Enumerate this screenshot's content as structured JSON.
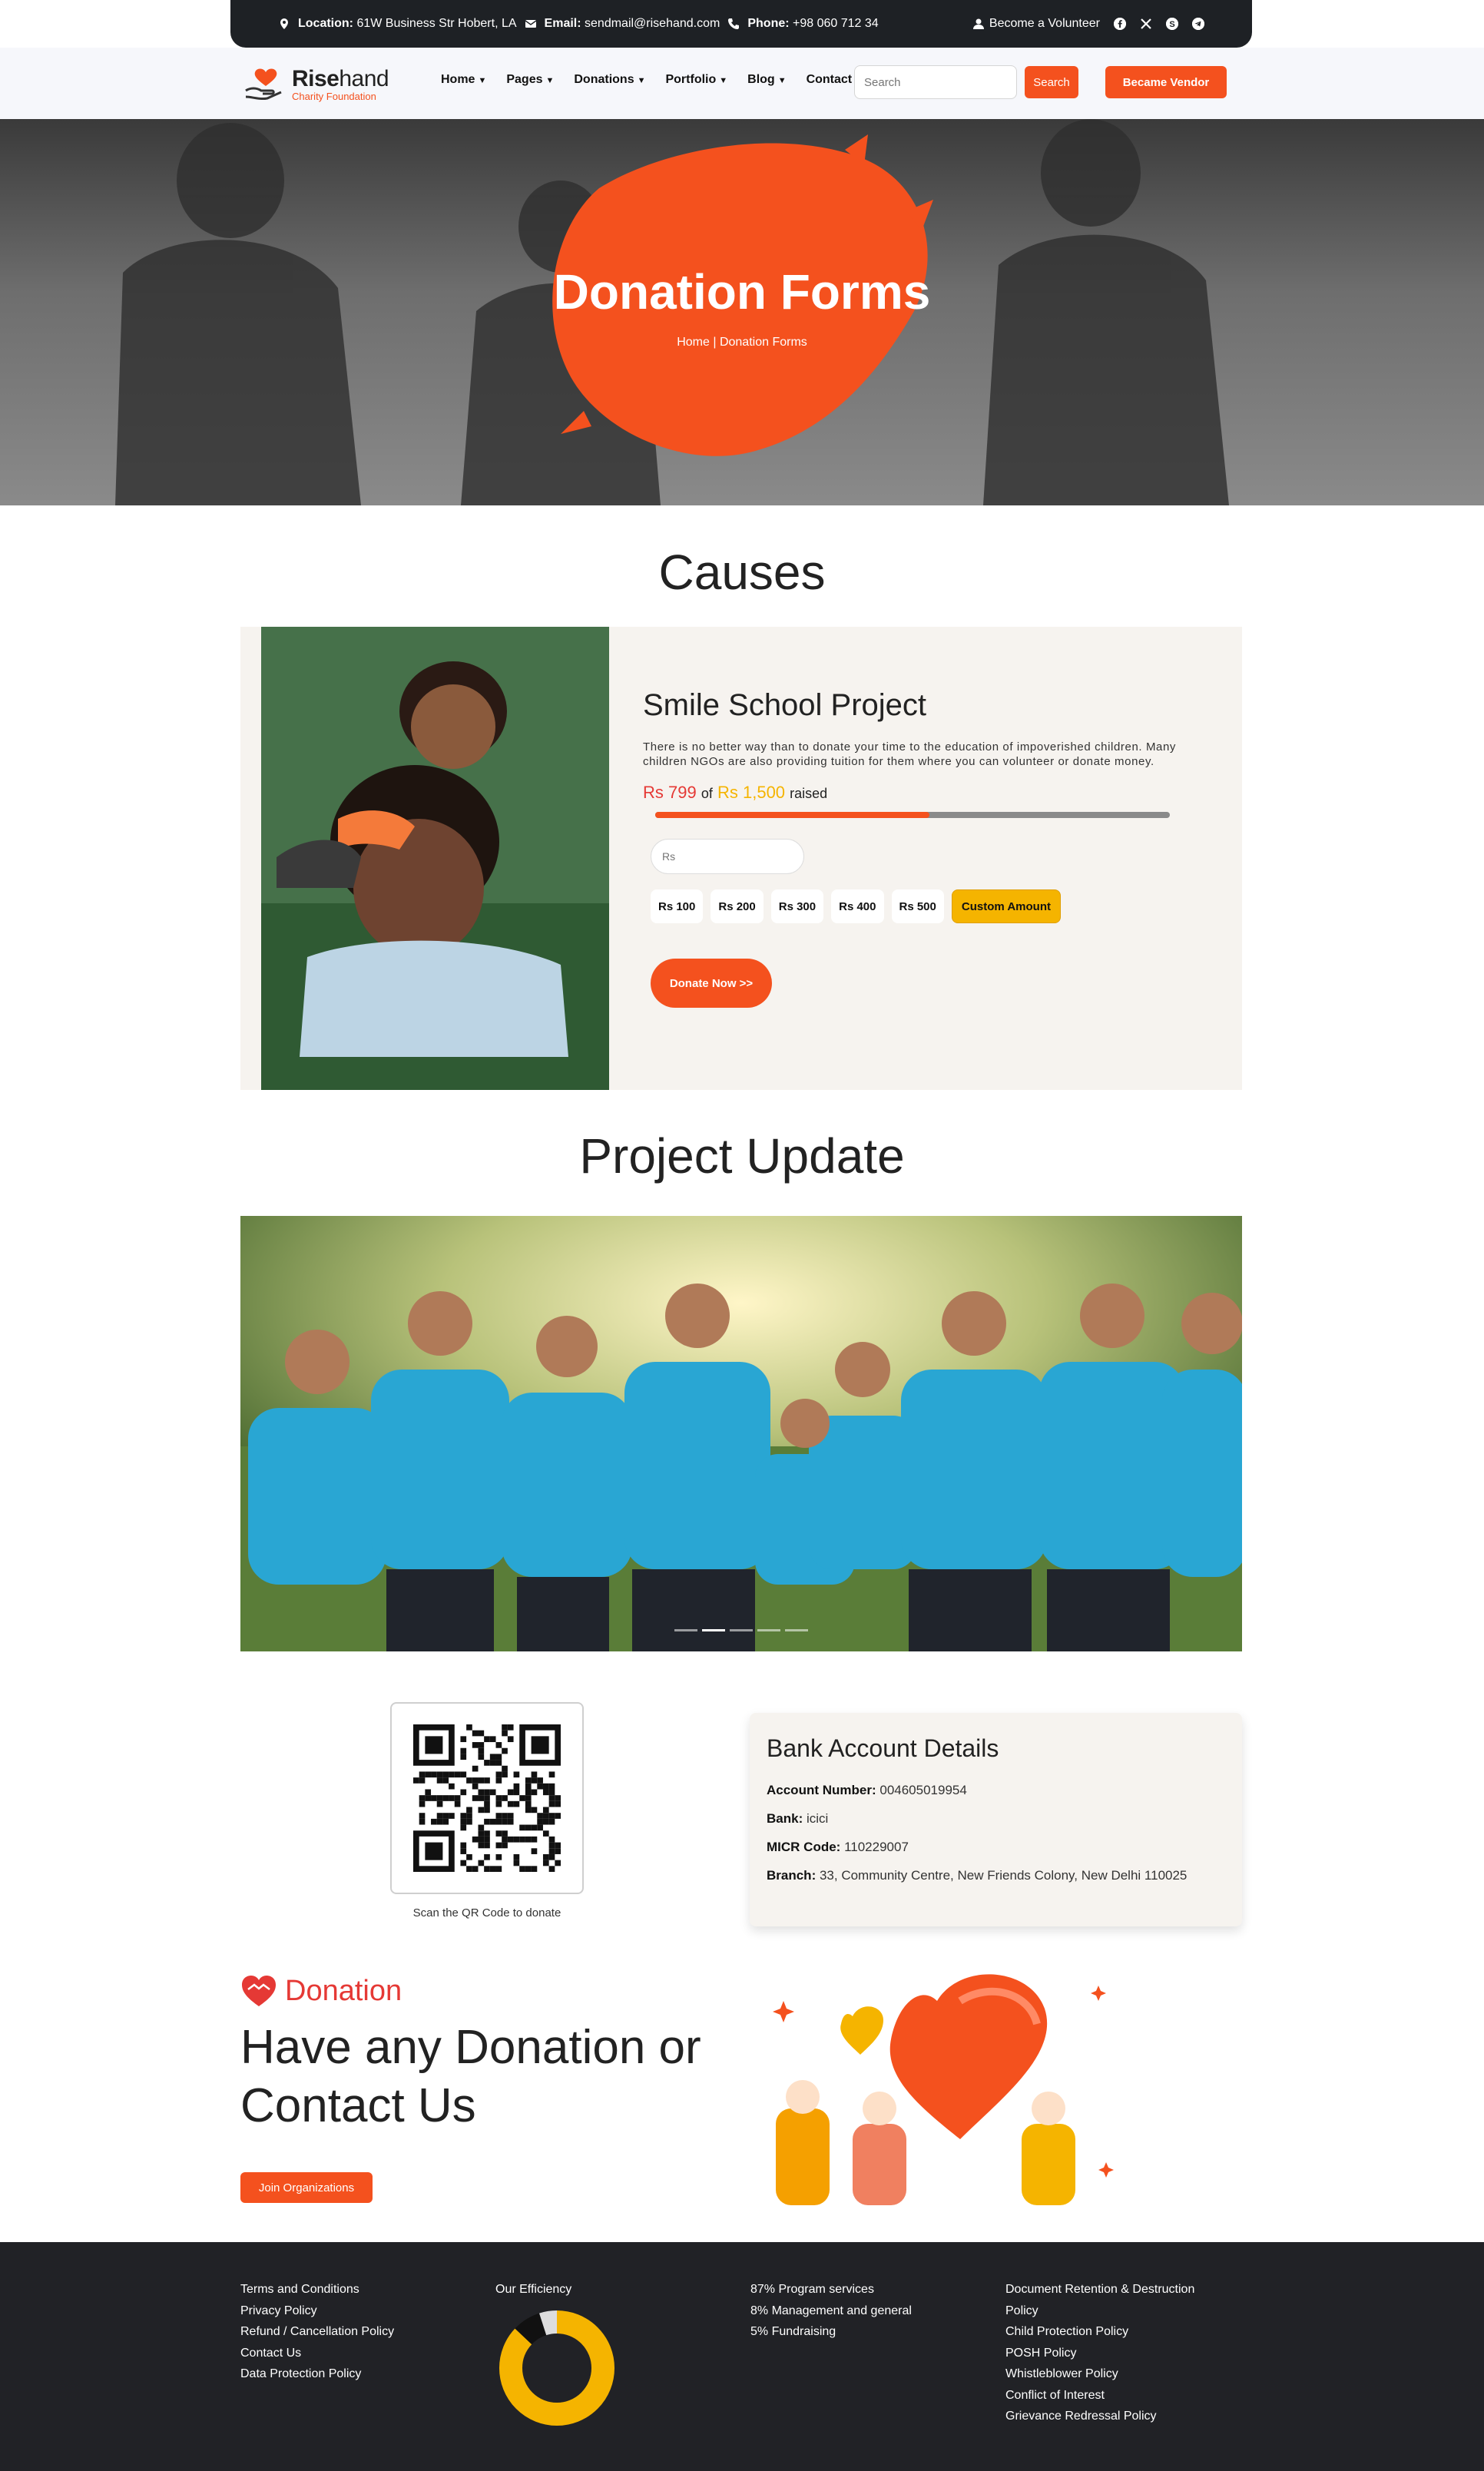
{
  "topbar": {
    "location_label": "Location:",
    "location_value": "61W Business Str Hobert, LA",
    "email_label": "Email:",
    "email_value": "sendmail@risehand.com",
    "phone_label": "Phone:",
    "phone_value": "+98 060 712 34",
    "volunteer": "Become a Volunteer"
  },
  "brand": {
    "name_bold": "Rise",
    "name_rest": "hand",
    "tagline": "Charity Foundation"
  },
  "menu": [
    {
      "label": "Home",
      "dropdown": true
    },
    {
      "label": "Pages",
      "dropdown": true
    },
    {
      "label": "Donations",
      "dropdown": true
    },
    {
      "label": "Portfolio",
      "dropdown": true
    },
    {
      "label": "Blog",
      "dropdown": true
    },
    {
      "label": "Contact",
      "dropdown": false
    }
  ],
  "search": {
    "placeholder": "Search",
    "button": "Search"
  },
  "vendor_button": "Became Vendor",
  "hero": {
    "title": "Donation Forms",
    "breadcrumb": "Home | Donation Forms"
  },
  "causes": {
    "heading": "Causes",
    "title": "Smile School Project",
    "description": "There is no better way than to donate your time to the education of impoverished children. Many children NGOs are also providing tuition for them where you can volunteer or donate money.",
    "raised_amount": "Rs 799",
    "of": "of",
    "goal_amount": "Rs 1,500",
    "raised_word": "raised",
    "progress_fraction": 0.533,
    "amount_placeholder": "Rs",
    "amounts": [
      "Rs 100",
      "Rs 200",
      "Rs 300",
      "Rs 400",
      "Rs 500"
    ],
    "custom": "Custom Amount",
    "donate": "Donate Now >>"
  },
  "project": {
    "heading": "Project Update",
    "active_slide": 2,
    "slides": 5
  },
  "qr": {
    "caption": "Scan the QR Code to donate"
  },
  "bank": {
    "title": "Bank Account Details",
    "rows": [
      {
        "label": "Account Number:",
        "value": "004605019954"
      },
      {
        "label": "Bank:",
        "value": "icici"
      },
      {
        "label": "MICR Code:",
        "value": "110229007"
      },
      {
        "label": "Branch:",
        "value": "33, Community Centre, New Friends Colony, New Delhi 110025"
      }
    ]
  },
  "donation": {
    "label": "Donation",
    "heading_line1": "Have any Donation or",
    "heading_line2": "Contact Us",
    "join": "Join Organizations"
  },
  "footer": {
    "col1": [
      "Terms and Conditions",
      "Privacy Policy",
      "Refund / Cancellation Policy",
      "Contact Us",
      "Data Protection Policy"
    ],
    "efficiency_title": "Our Efficiency",
    "col3": [
      "87% Program services",
      "8% Management and general",
      "5% Fundraising"
    ],
    "col4": [
      "Document Retention & Destruction",
      "Policy",
      "Child Protection Policy",
      "POSH Policy",
      "Whistleblower Policy",
      "Conflict of Interest",
      "Grievance Redressal Policy"
    ]
  },
  "chart_data": {
    "type": "pie",
    "categories": [
      "Program services",
      "Management and general",
      "Fundraising"
    ],
    "values": [
      87,
      8,
      5
    ],
    "colors": [
      "#f5b400",
      "#111111",
      "#dddddd"
    ]
  }
}
